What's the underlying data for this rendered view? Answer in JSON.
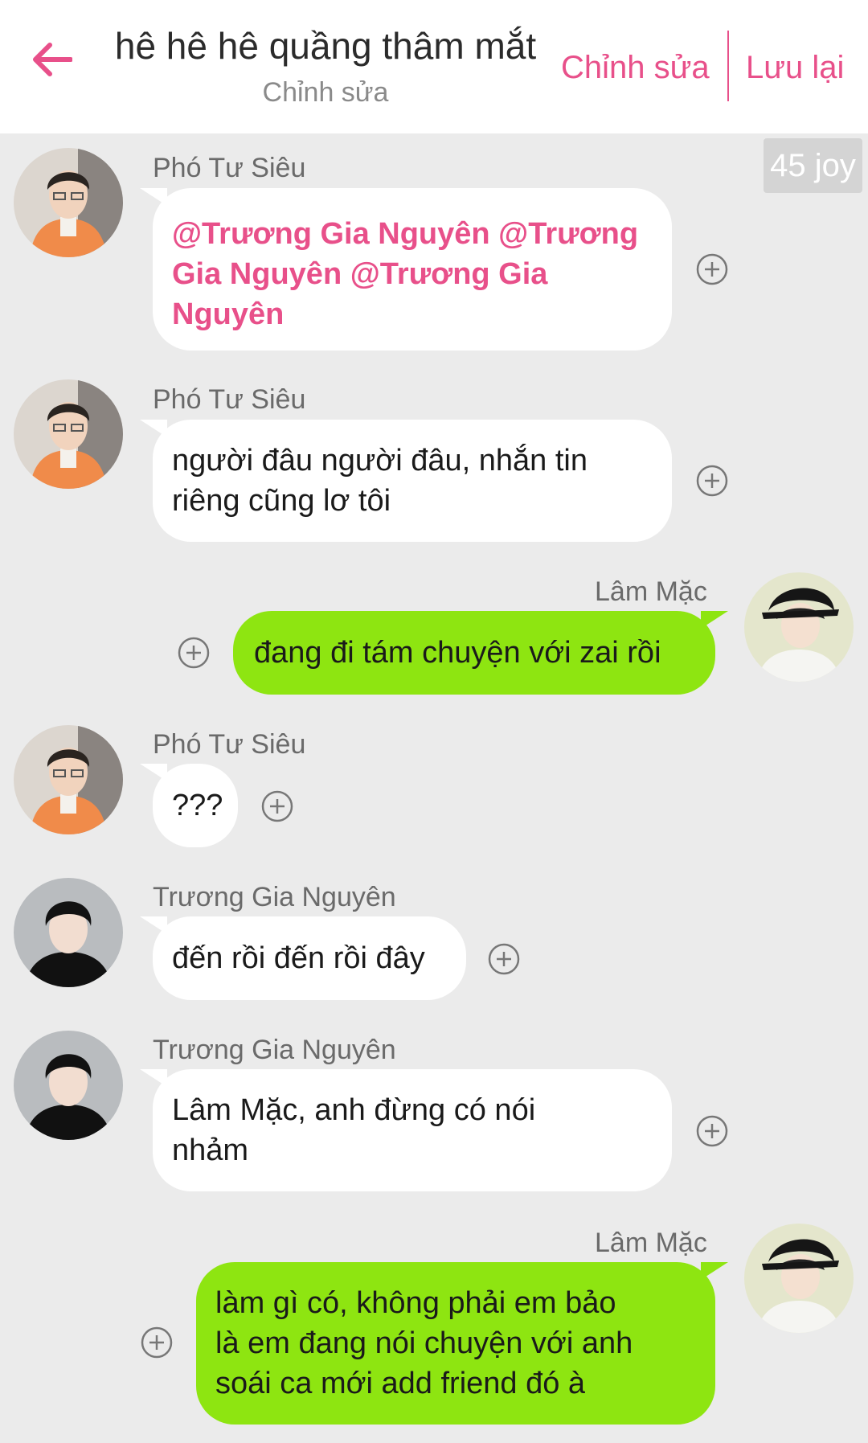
{
  "header": {
    "title": "hê hê hê quầng thâm mắt",
    "subtitle": "Chỉnh sửa",
    "edit_label": "Chỉnh sửa",
    "save_label": "Lưu lại"
  },
  "joy_badge": "45 joy",
  "colors": {
    "accent": "#e8508a",
    "incoming_bubble": "#ffffff",
    "outgoing_bubble": "#8ee511",
    "background": "#ebebeb"
  },
  "messages": [
    {
      "sender": "Phó Tư Siêu",
      "direction": "incoming",
      "lines": [
        "@Trương Gia Nguyên @Trương",
        "Gia Nguyên @Trương Gia",
        "Nguyên"
      ],
      "is_mention": true
    },
    {
      "sender": "Phó Tư Siêu",
      "direction": "incoming",
      "lines": [
        "người đâu người đâu, nhắn tin",
        "riêng cũng lơ tôi"
      ]
    },
    {
      "sender": "Lâm Mặc",
      "direction": "outgoing",
      "lines": [
        "đang đi tám chuyện với zai rồi"
      ]
    },
    {
      "sender": "Phó Tư Siêu",
      "direction": "incoming",
      "lines": [
        "???"
      ]
    },
    {
      "sender": "Trương Gia Nguyên",
      "direction": "incoming",
      "lines": [
        "đến rồi đến rồi đây"
      ]
    },
    {
      "sender": "Trương Gia Nguyên",
      "direction": "incoming",
      "lines": [
        "Lâm Mặc, anh đừng có nói",
        "nhảm"
      ]
    },
    {
      "sender": "Lâm Mặc",
      "direction": "outgoing",
      "lines": [
        "làm gì có, không phải em bảo",
        "là em đang nói chuyện với anh",
        "soái ca mới add friend đó à"
      ]
    }
  ]
}
